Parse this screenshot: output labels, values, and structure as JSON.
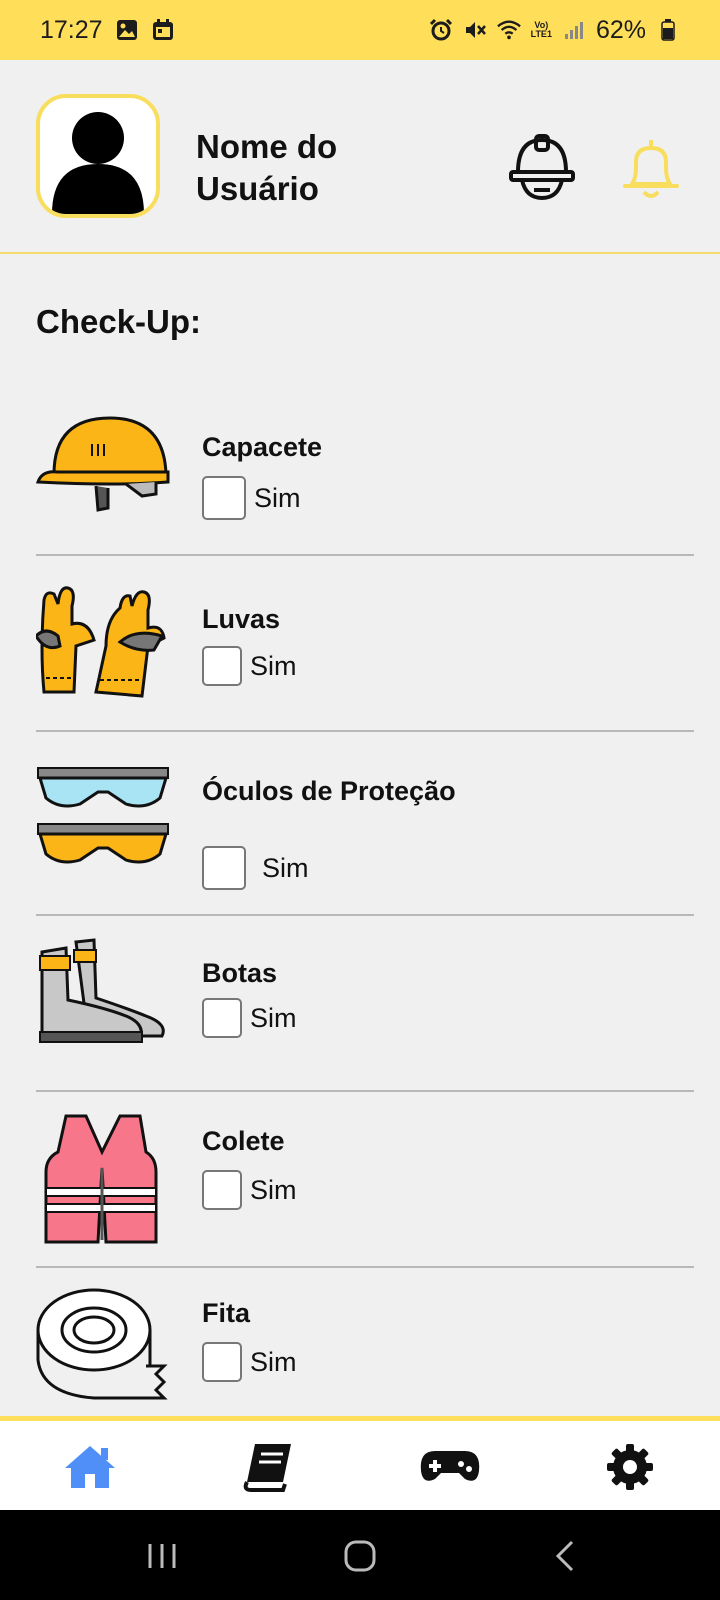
{
  "status_bar": {
    "time": "17:27",
    "network_top": "Vo)",
    "network_bottom": "LTE1",
    "battery": "62%"
  },
  "header": {
    "username": "Nome do Usuário"
  },
  "section_title": "Check-Up:",
  "items": [
    {
      "label": "Capacete",
      "check_label": "Sim",
      "checked": false,
      "icon": "hard-hat-icon"
    },
    {
      "label": "Luvas",
      "check_label": "Sim",
      "checked": false,
      "icon": "gloves-icon"
    },
    {
      "label": "Óculos de Proteção",
      "check_label": "Sim",
      "checked": false,
      "icon": "safety-glasses-icon"
    },
    {
      "label": "Botas",
      "check_label": "Sim",
      "checked": false,
      "icon": "boots-icon"
    },
    {
      "label": "Colete",
      "check_label": "Sim",
      "checked": false,
      "icon": "safety-vest-icon"
    },
    {
      "label": "Fita",
      "check_label": "Sim",
      "checked": false,
      "icon": "tape-icon"
    }
  ],
  "bottom_nav": [
    {
      "icon": "home-icon",
      "active": true
    },
    {
      "icon": "book-icon",
      "active": false
    },
    {
      "icon": "gamepad-icon",
      "active": false
    },
    {
      "icon": "gear-icon",
      "active": false
    }
  ],
  "colors": {
    "accent": "#ffde59",
    "active_nav": "#4f8ff7",
    "bell": "#f8de5c",
    "background": "#f0f0f0"
  }
}
